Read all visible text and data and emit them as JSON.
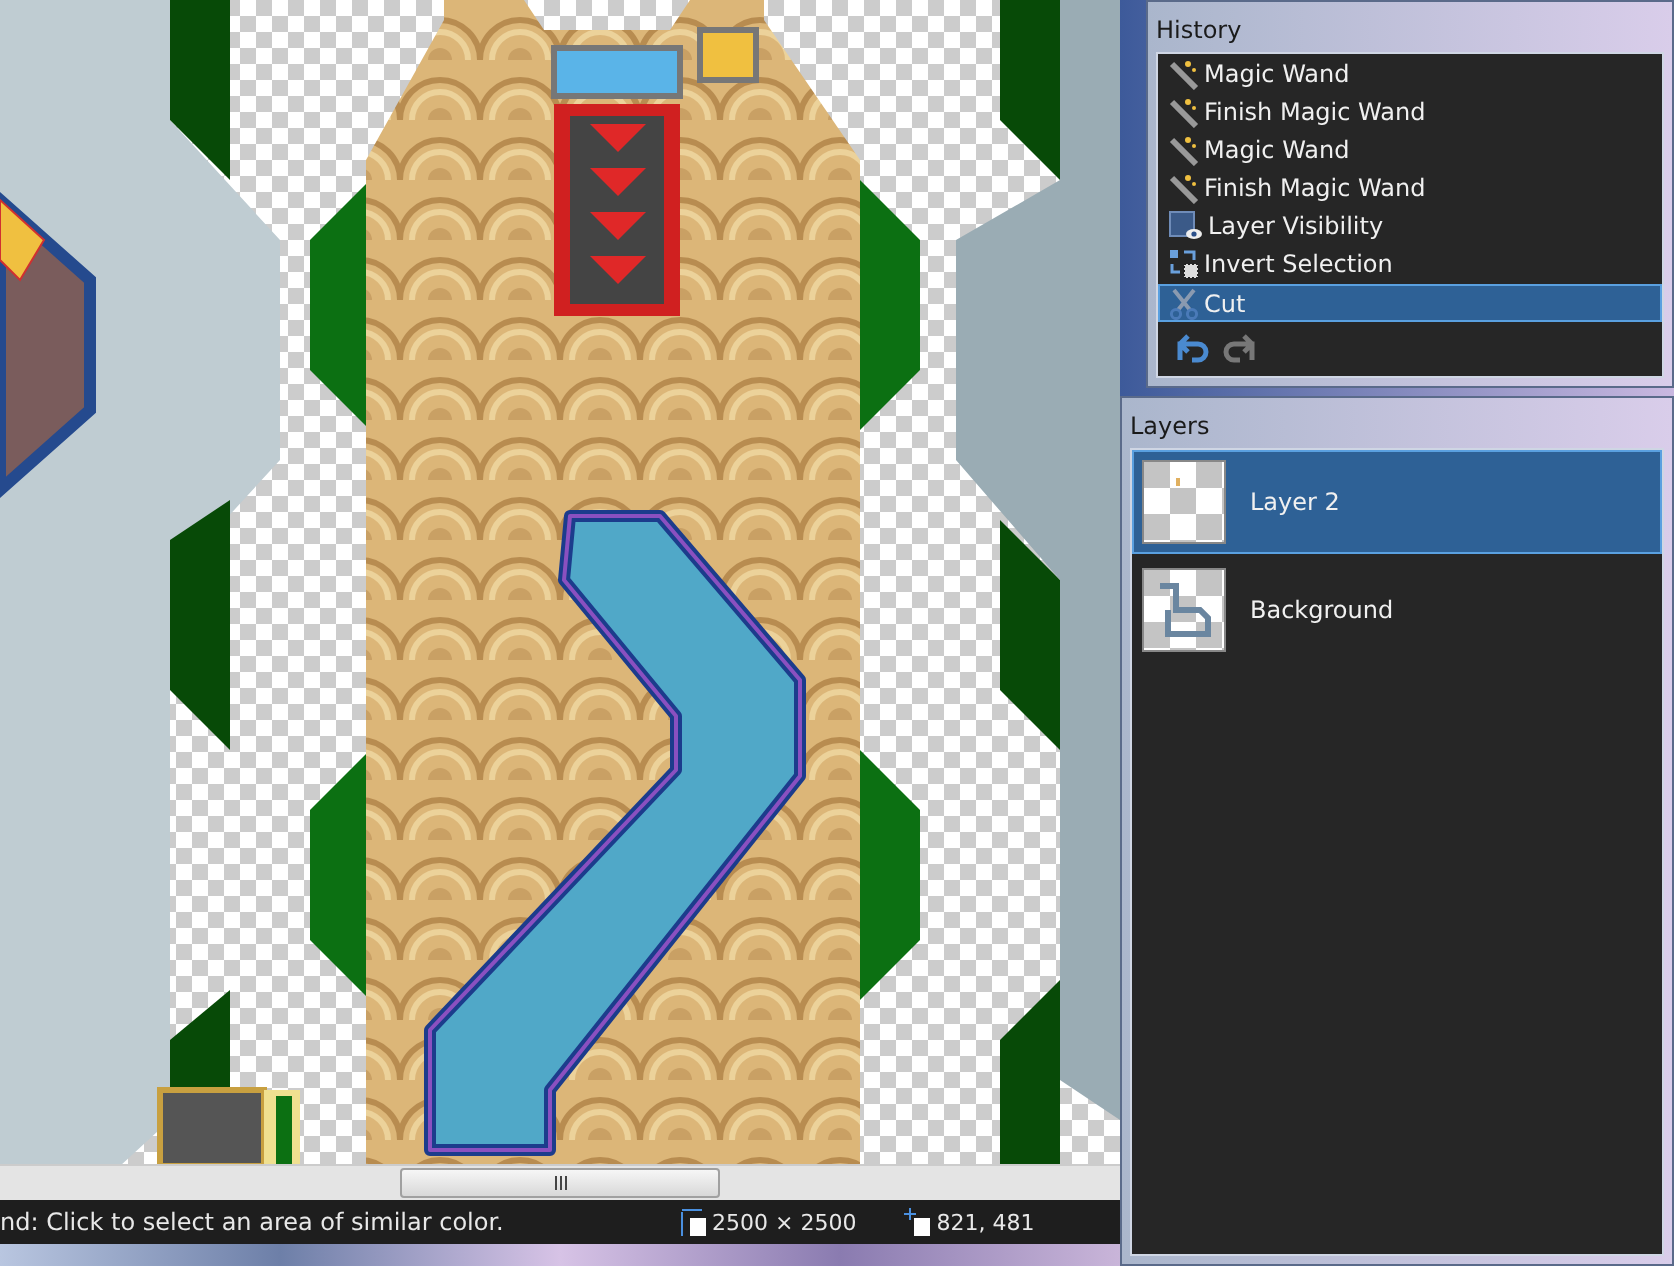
{
  "history": {
    "title": "History",
    "items": [
      {
        "label": "Magic Wand",
        "kind": "wand",
        "selected": false
      },
      {
        "label": "Finish Magic Wand",
        "kind": "wand",
        "selected": false
      },
      {
        "label": "Magic Wand",
        "kind": "wand",
        "selected": false
      },
      {
        "label": "Finish Magic Wand",
        "kind": "wand",
        "selected": false
      },
      {
        "label": "Layer Visibility",
        "kind": "visibility",
        "selected": false
      },
      {
        "label": "Invert Selection",
        "kind": "invert",
        "selected": false
      },
      {
        "label": "Cut",
        "kind": "cut",
        "selected": true
      }
    ]
  },
  "layers": {
    "title": "Layers",
    "items": [
      {
        "name": "Layer 2",
        "kind": "empty",
        "selected": true
      },
      {
        "name": "Background",
        "kind": "map",
        "selected": false
      }
    ]
  },
  "status_bar": {
    "hint": "nd: Click to select an area of similar color.",
    "image_size": "2500 × 2500",
    "cursor": "821, 481"
  }
}
